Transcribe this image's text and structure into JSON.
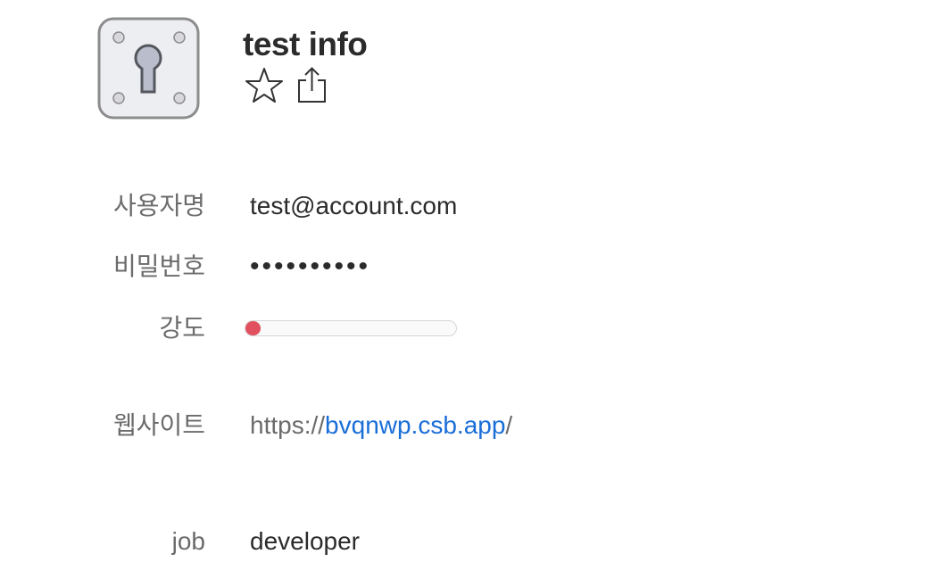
{
  "item": {
    "title": "test info",
    "icon": "keyhole-key-icon",
    "actions": [
      {
        "name": "favorite",
        "icon": "star-icon"
      },
      {
        "name": "share",
        "icon": "share-icon"
      }
    ]
  },
  "fields": {
    "username": {
      "label": "사용자명",
      "value": "test@account.com"
    },
    "password": {
      "label": "비밀번호",
      "value": "••••••••••"
    },
    "strength": {
      "label": "강도",
      "level": 0.04,
      "color": "#e0505e"
    },
    "website": {
      "label": "웹사이트",
      "prefix": "https://",
      "host": "bvqnwp.csb.app",
      "suffix": "/"
    },
    "job": {
      "label": "job",
      "value": "developer"
    }
  }
}
